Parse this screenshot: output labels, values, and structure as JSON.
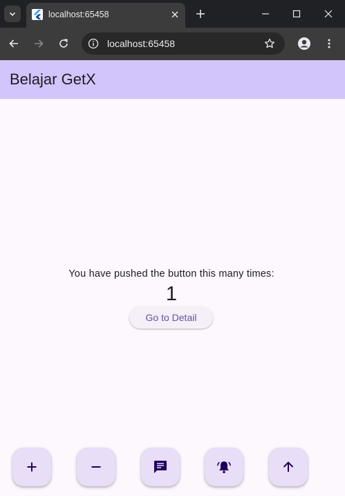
{
  "browser": {
    "tab_title": "localhost:65458",
    "url": "localhost:65458"
  },
  "app": {
    "title": "Belajar GetX",
    "counter_label": "You have pushed the button this many times:",
    "counter_value": "1",
    "detail_button_label": "Go to Detail"
  },
  "fabs": [
    {
      "icon": "plus-icon"
    },
    {
      "icon": "minus-icon"
    },
    {
      "icon": "message-icon"
    },
    {
      "icon": "notification-ringing-icon"
    },
    {
      "icon": "arrow-up-icon"
    }
  ],
  "colors": {
    "appbar": "#d2c5fb",
    "background": "#fdf7fe",
    "fab": "#e8def8",
    "fab_icon": "#21005d",
    "button_text": "#6750a4"
  }
}
